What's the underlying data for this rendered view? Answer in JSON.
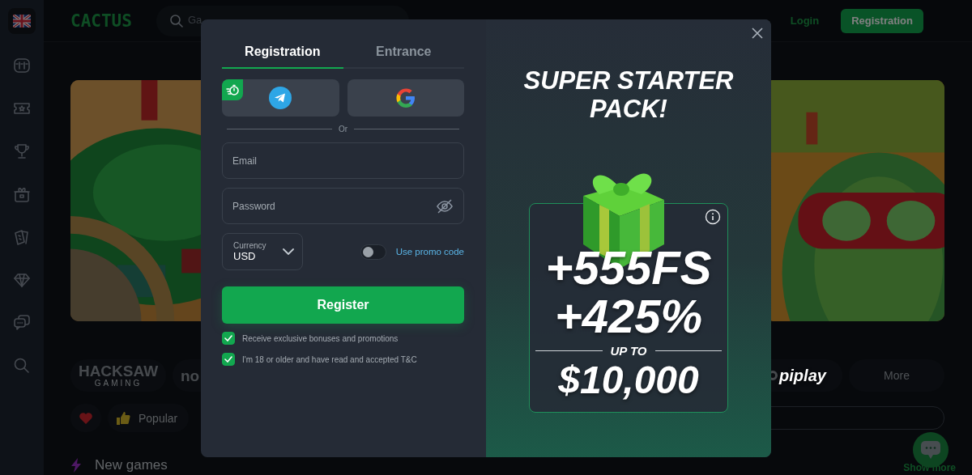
{
  "header": {
    "logo": "CACTUS",
    "search": {
      "placeholder": "Ga"
    },
    "login": "Login",
    "register": "Registration"
  },
  "providers_left": [
    {
      "name": "HACKSAW",
      "sub": "GAMING"
    },
    {
      "name": "no"
    }
  ],
  "providers_right": [
    {
      "name": "piplay"
    }
  ],
  "more_button": "More",
  "filters": [
    {
      "kind": "favorite"
    },
    {
      "kind": "popular",
      "label": "Popular"
    }
  ],
  "section": {
    "title": "New games",
    "show_more": "Show more"
  },
  "modal": {
    "tabs": [
      {
        "label": "Registration",
        "selected": true
      },
      {
        "label": "Entrance",
        "selected": false
      }
    ],
    "divider": "Or",
    "email": {
      "placeholder": "Email"
    },
    "password": {
      "placeholder": "Password"
    },
    "currency": {
      "label": "Currency",
      "value": "USD"
    },
    "promo_code": {
      "on": false,
      "label": "Use promo code"
    },
    "submit": "Register",
    "consents": [
      {
        "label": "Receive exclusive bonuses and promotions",
        "checked": true
      },
      {
        "label": "I'm 18 or older and have read and accepted T&C",
        "checked": true
      }
    ],
    "offer": {
      "title": "SUPER STARTER PACK!",
      "lines": [
        "+555FS",
        "+425%"
      ],
      "up_to": "UP TO",
      "amount": "$10,000"
    }
  }
}
